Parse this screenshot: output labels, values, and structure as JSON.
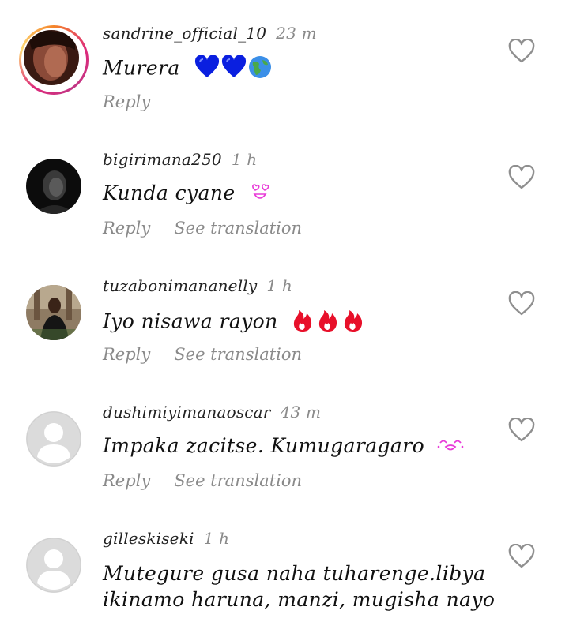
{
  "comments": [
    {
      "username": "sandrine_official_10",
      "time": "23 m",
      "text": "Murera",
      "emojis": [
        "blue-heart",
        "blue-heart",
        "globe-americas"
      ],
      "reply_label": "Reply",
      "translation_label": "",
      "has_story_ring": true
    },
    {
      "username": "bigirimana250",
      "time": "1 h",
      "text": "Kunda cyane",
      "emojis": [
        "heart-eyes"
      ],
      "reply_label": "Reply",
      "translation_label": "See translation"
    },
    {
      "username": "tuzabonimananelly",
      "time": "1 h",
      "text": "Iyo nisawa rayon",
      "emojis": [
        "fire",
        "fire",
        "fire"
      ],
      "reply_label": "Reply",
      "translation_label": "See translation"
    },
    {
      "username": "dushimiyimanaoscar",
      "time": "43 m",
      "text": "Impaka zacitse. Kumugaragaro",
      "emojis": [
        "kissing-face"
      ],
      "reply_label": "Reply",
      "translation_label": "See translation",
      "default_avatar": true
    },
    {
      "username": "gilleskiseki",
      "time": "1 h",
      "text_line1": "Mutegure gusa naha tuharenge.libya",
      "text_line2": "ikinamo haruna, manzi, mugisha nayo",
      "default_avatar": true
    }
  ],
  "colors": {
    "heart_blue": "#0a1fe0",
    "fire_red": "#e8102a",
    "emoji_pink": "#e83ad8",
    "muted_text": "#8a8a8a",
    "default_avatar_bg": "#dbdbdb"
  },
  "icons": {
    "like": "heart-outline-icon"
  }
}
